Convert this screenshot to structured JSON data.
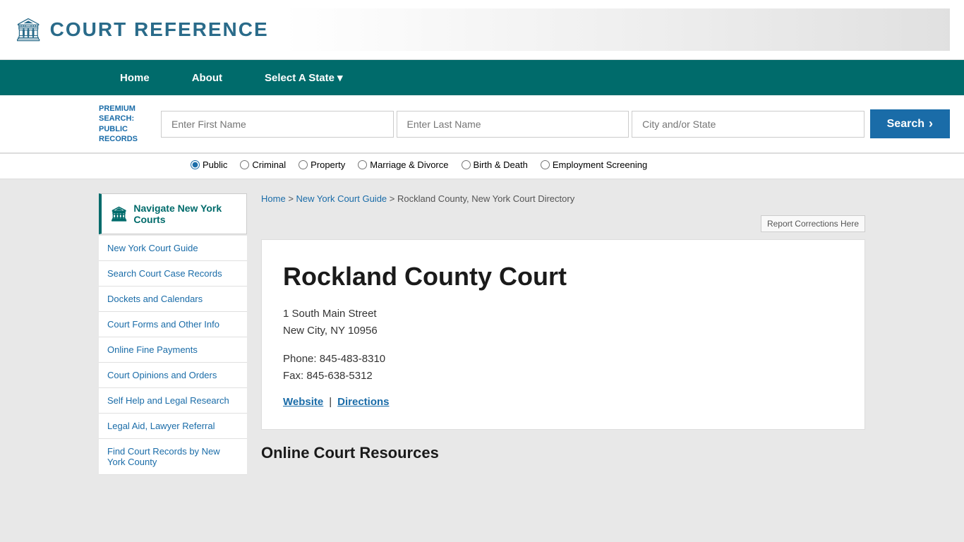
{
  "site": {
    "logo_icon": "🏛",
    "logo_text": "COURT REFERENCE"
  },
  "nav": {
    "items": [
      {
        "id": "home",
        "label": "Home"
      },
      {
        "id": "about",
        "label": "About"
      },
      {
        "id": "select-state",
        "label": "Select A State",
        "has_dropdown": true
      }
    ]
  },
  "search_bar": {
    "premium_label": "PREMIUM SEARCH: PUBLIC RECORDS",
    "first_name_placeholder": "Enter First Name",
    "last_name_placeholder": "Enter Last Name",
    "city_state_placeholder": "City and/or State",
    "search_button": "Search"
  },
  "search_filters": {
    "options": [
      {
        "id": "public",
        "label": "Public",
        "checked": true
      },
      {
        "id": "criminal",
        "label": "Criminal",
        "checked": false
      },
      {
        "id": "property",
        "label": "Property",
        "checked": false
      },
      {
        "id": "marriage-divorce",
        "label": "Marriage & Divorce",
        "checked": false
      },
      {
        "id": "birth-death",
        "label": "Birth & Death",
        "checked": false
      },
      {
        "id": "employment",
        "label": "Employment Screening",
        "checked": false
      }
    ]
  },
  "breadcrumb": {
    "items": [
      {
        "label": "Home",
        "url": "#"
      },
      {
        "label": "New York Court Guide",
        "url": "#"
      },
      {
        "label": "Rockland County, New York Court Directory",
        "url": null
      }
    ]
  },
  "sidebar": {
    "active_item": {
      "icon": "🏛",
      "label": "Navigate New York Courts"
    },
    "links": [
      {
        "id": "ny-court-guide",
        "label": "New York Court Guide"
      },
      {
        "id": "search-court-records",
        "label": "Search Court Case Records"
      },
      {
        "id": "dockets-calendars",
        "label": "Dockets and Calendars"
      },
      {
        "id": "court-forms",
        "label": "Court Forms and Other Info"
      },
      {
        "id": "online-fine",
        "label": "Online Fine Payments"
      },
      {
        "id": "court-opinions",
        "label": "Court Opinions and Orders"
      },
      {
        "id": "self-help",
        "label": "Self Help and Legal Research"
      },
      {
        "id": "legal-aid",
        "label": "Legal Aid, Lawyer Referral"
      },
      {
        "id": "find-court-records",
        "label": "Find Court Records by New York County"
      }
    ]
  },
  "report_corrections": {
    "label": "Report Corrections Here"
  },
  "court": {
    "name": "Rockland County Court",
    "address_line1": "1 South Main Street",
    "address_line2": "New City, NY 10956",
    "phone": "Phone: 845-483-8310",
    "fax": "Fax: 845-638-5312",
    "website_label": "Website",
    "directions_label": "Directions",
    "separator": "|"
  },
  "online_resources": {
    "title": "Online Court Resources"
  }
}
